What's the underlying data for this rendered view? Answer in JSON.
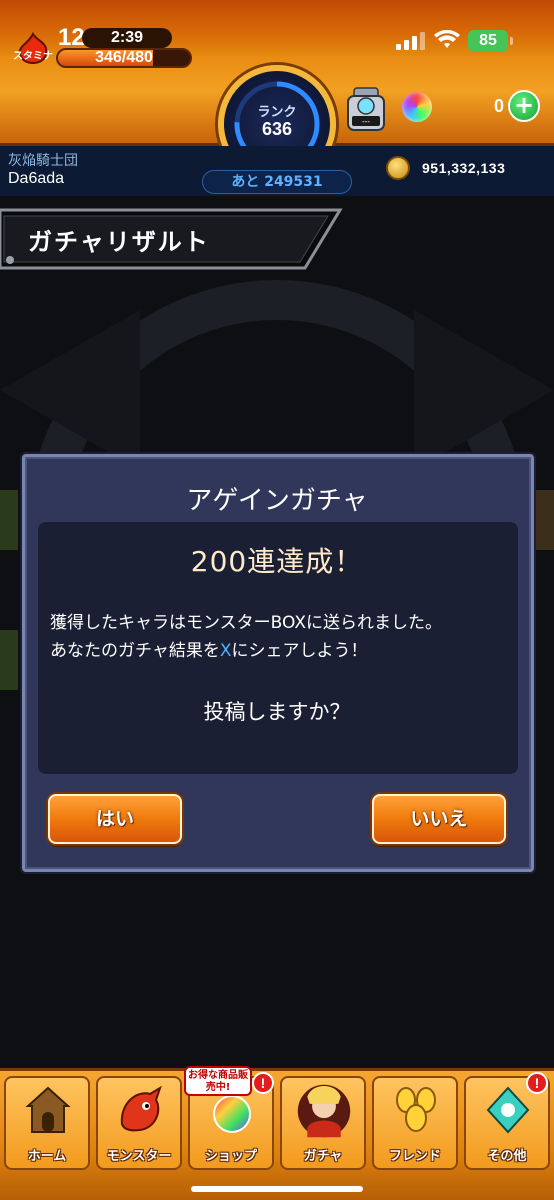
{
  "status_bar": {
    "time": "12:59",
    "battery": "85"
  },
  "header": {
    "stamina_label": "スタミナ",
    "stamina_timer": "2:39",
    "stamina_value": "346/480",
    "stamina_fraction": 0.72,
    "rank_label": "ランク",
    "rank_value": "636",
    "box_label": "---",
    "orb_count": "0",
    "guild_name": "灰焔騎士団",
    "player_name": "Da6ada",
    "next_rank": "あと 249531",
    "coin_count": "951,332,133"
  },
  "page": {
    "title": "ガチャリザルト"
  },
  "dialog": {
    "title": "アゲインガチャ",
    "headline": "200連達成！",
    "body_line1": "獲得したキャラはモンスターBOXに送られました。",
    "body_line2_before": "あなたのガチャ結果を",
    "body_line2_accent": "X",
    "body_line2_after": "にシェアしよう！",
    "question": "投稿しますか？",
    "yes_label": "はい",
    "no_label": "いいえ"
  },
  "bottom_nav": {
    "items": [
      {
        "label": "ホーム",
        "icon": "home-icon"
      },
      {
        "label": "モンスター",
        "icon": "monster-icon"
      },
      {
        "label": "ショップ",
        "icon": "shop-icon"
      },
      {
        "label": "ガチャ",
        "icon": "gacha-icon"
      },
      {
        "label": "フレンド",
        "icon": "friend-icon"
      },
      {
        "label": "その他",
        "icon": "other-icon"
      }
    ],
    "shop_promo": "お得な商品販売中!",
    "badge": "!"
  },
  "colors": {
    "accent_orange": "#f07a0c",
    "dialog_bg": "#30375a",
    "x_accent": "#4db4ff"
  }
}
